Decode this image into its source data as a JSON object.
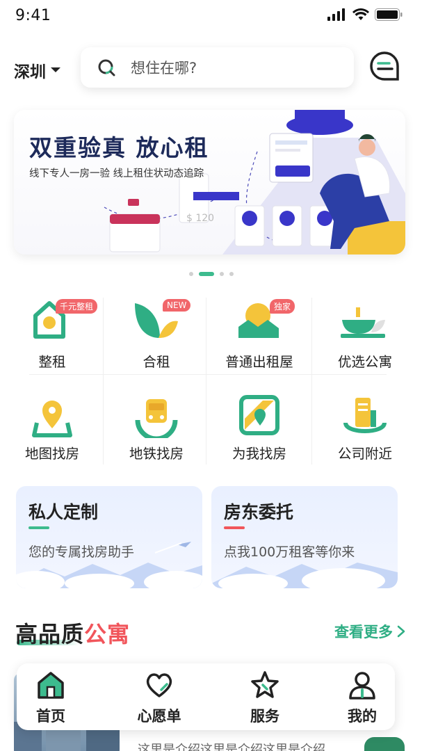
{
  "status_bar": {
    "time": "9:41"
  },
  "header": {
    "city": "深圳",
    "search_placeholder": "想住在哪?"
  },
  "banner": {
    "title": "双重验真 放心租",
    "subtitle": "线下专人一房一验  线上租住状动态追踪",
    "price_tag": "$ 120",
    "page_count": 4,
    "active_page": 2
  },
  "categories": [
    {
      "label": "整租",
      "badge": "千元整租",
      "icon": "house-icon"
    },
    {
      "label": "合租",
      "badge": "NEW",
      "icon": "leaf-icon"
    },
    {
      "label": "普通出租屋",
      "badge": "独家",
      "icon": "sunrise-house-icon"
    },
    {
      "label": "优选公寓",
      "badge": "",
      "icon": "bowl-icon"
    },
    {
      "label": "地图找房",
      "badge": "",
      "icon": "map-pin-icon"
    },
    {
      "label": "地铁找房",
      "badge": "",
      "icon": "metro-icon"
    },
    {
      "label": "为我找房",
      "badge": "",
      "icon": "map-icon"
    },
    {
      "label": "公司附近",
      "badge": "",
      "icon": "building-icon"
    }
  ],
  "cards": [
    {
      "title": "私人定制",
      "subtitle": "您的专属找房助手",
      "accent": "#3dbb8e"
    },
    {
      "title": "房东委托",
      "subtitle": "点我100万租客等你来",
      "accent": "#f1555b"
    }
  ],
  "section": {
    "title_part1": "高品质",
    "title_part2": "公寓",
    "more": "查看更多"
  },
  "listing": {
    "desc": "这里是介绍这里是介绍这里是介绍"
  },
  "tabbar": [
    {
      "label": "首页",
      "icon": "home-icon",
      "active": true
    },
    {
      "label": "心愿单",
      "icon": "heart-icon",
      "active": false
    },
    {
      "label": "服务",
      "icon": "star-icon",
      "active": false
    },
    {
      "label": "我的",
      "icon": "user-icon",
      "active": false
    }
  ],
  "colors": {
    "brand_green": "#3dbb8e",
    "accent_red": "#f1555b",
    "navy": "#1d2a5a"
  }
}
